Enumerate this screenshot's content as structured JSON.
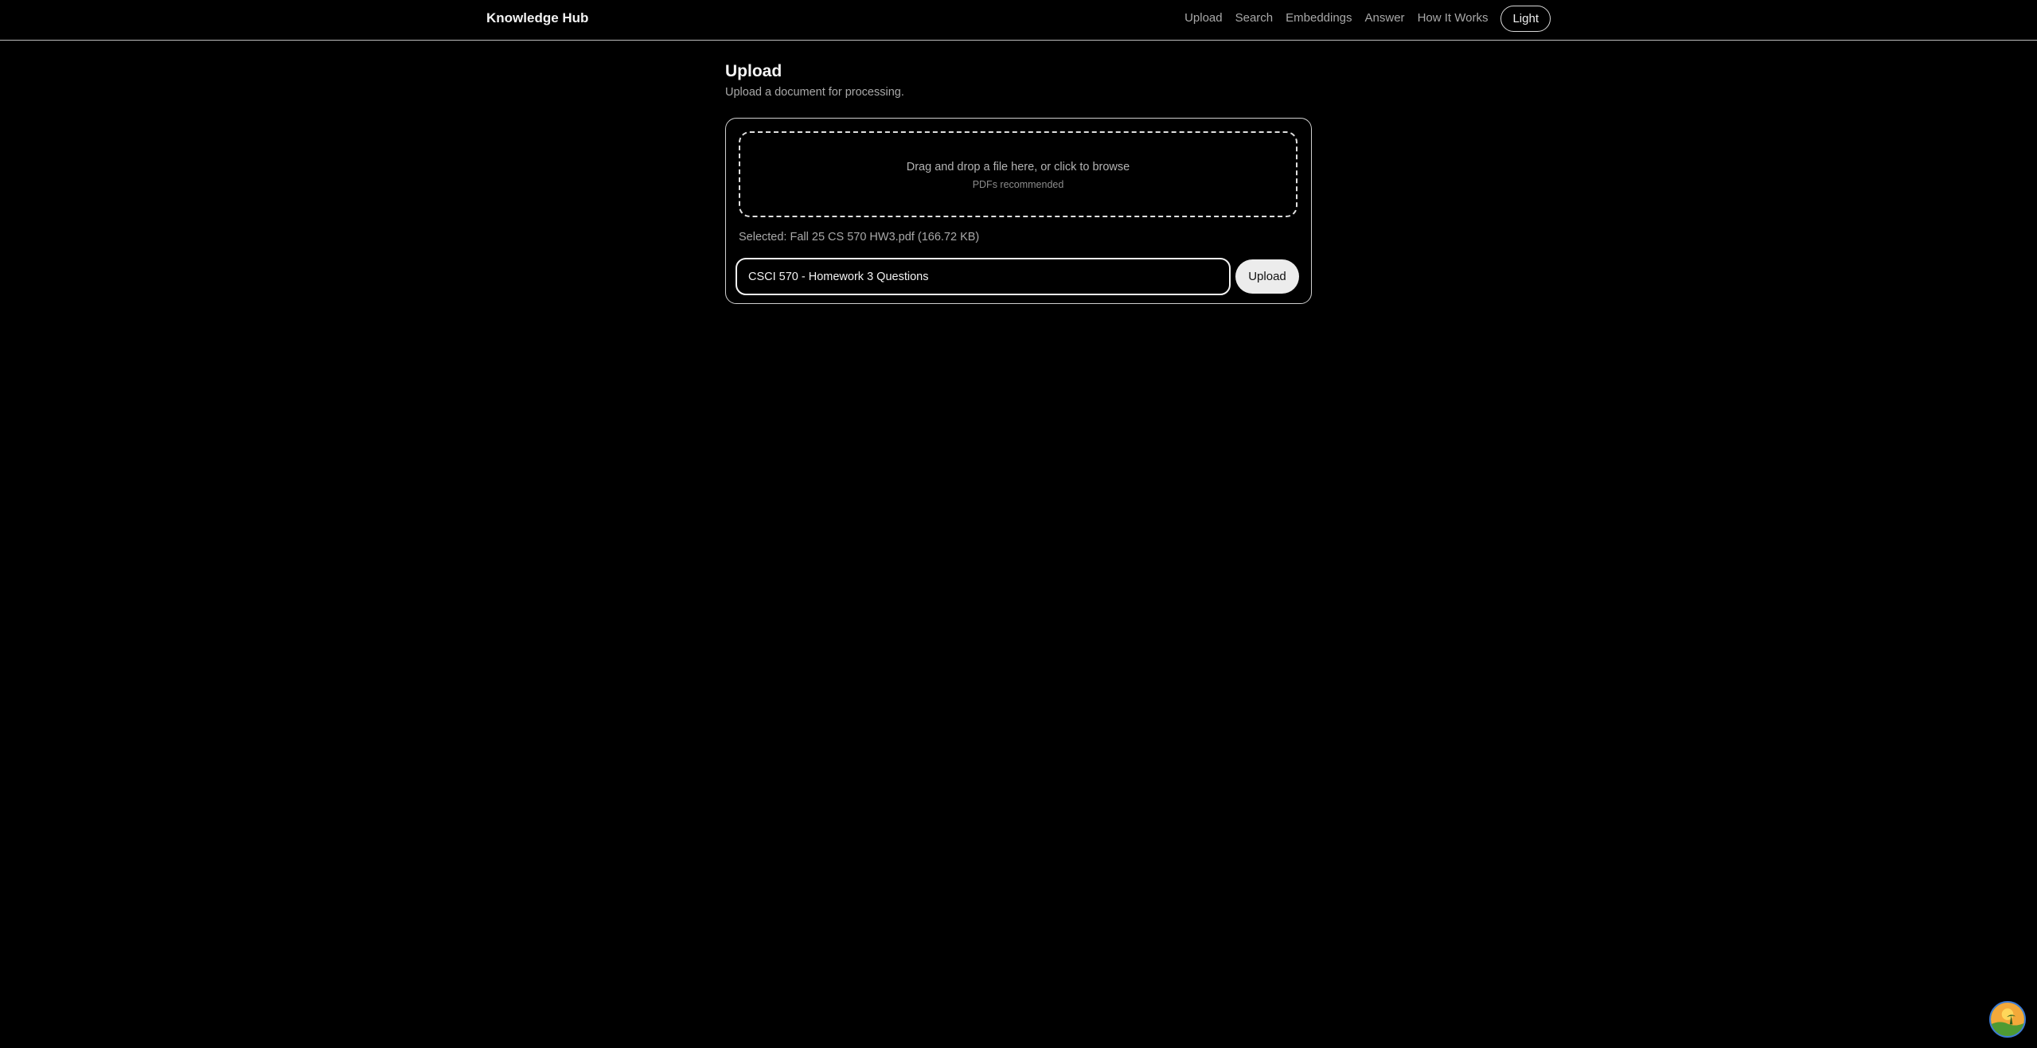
{
  "header": {
    "brand": "Knowledge Hub",
    "nav": [
      {
        "label": "Upload"
      },
      {
        "label": "Search"
      },
      {
        "label": "Embeddings"
      },
      {
        "label": "Answer"
      },
      {
        "label": "How It Works"
      }
    ],
    "theme_toggle": "Light"
  },
  "main": {
    "title": "Upload",
    "subtitle": "Upload a document for processing.",
    "dropzone": {
      "title": "Drag and drop a file here, or click to browse",
      "hint": "PDFs recommended"
    },
    "selected_file": "Selected: Fall 25 CS 570 HW3.pdf (166.72 KB)",
    "title_input": {
      "value": "CSCI 570 - Homework 3 Questions"
    },
    "upload_button": "Upload"
  },
  "colors": {
    "background": "#000000",
    "card_border": "#cfcfcf",
    "button_bg": "#ececec",
    "avatar_ring": "#3c7bd6"
  },
  "icons": {
    "floating_button": "avatar-badge-icon"
  }
}
